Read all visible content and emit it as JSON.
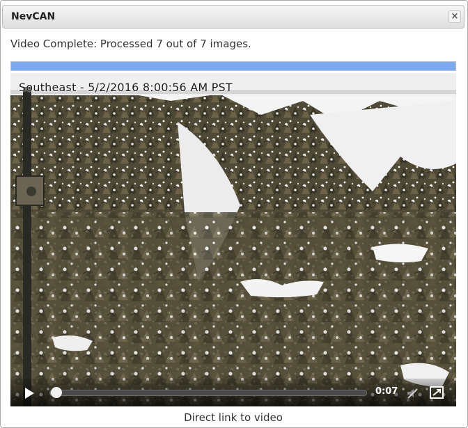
{
  "window": {
    "title": "NevCAN",
    "close_glyph": "×"
  },
  "status": {
    "text": "Video Complete: Processed 7 out of 7 images.",
    "progress_percent": 100,
    "progress_color": "#7aaaf2"
  },
  "video": {
    "overlay_caption": "Southeast - 5/2/2016 8:00:56 AM PST",
    "time": "0:07",
    "playback_progress_percent": 2,
    "controls": {
      "play_icon": "play-icon",
      "mute_icon": "volume-muted-icon",
      "fullscreen_icon": "fullscreen-icon"
    }
  },
  "footer": {
    "link_text": "Direct link to video"
  }
}
